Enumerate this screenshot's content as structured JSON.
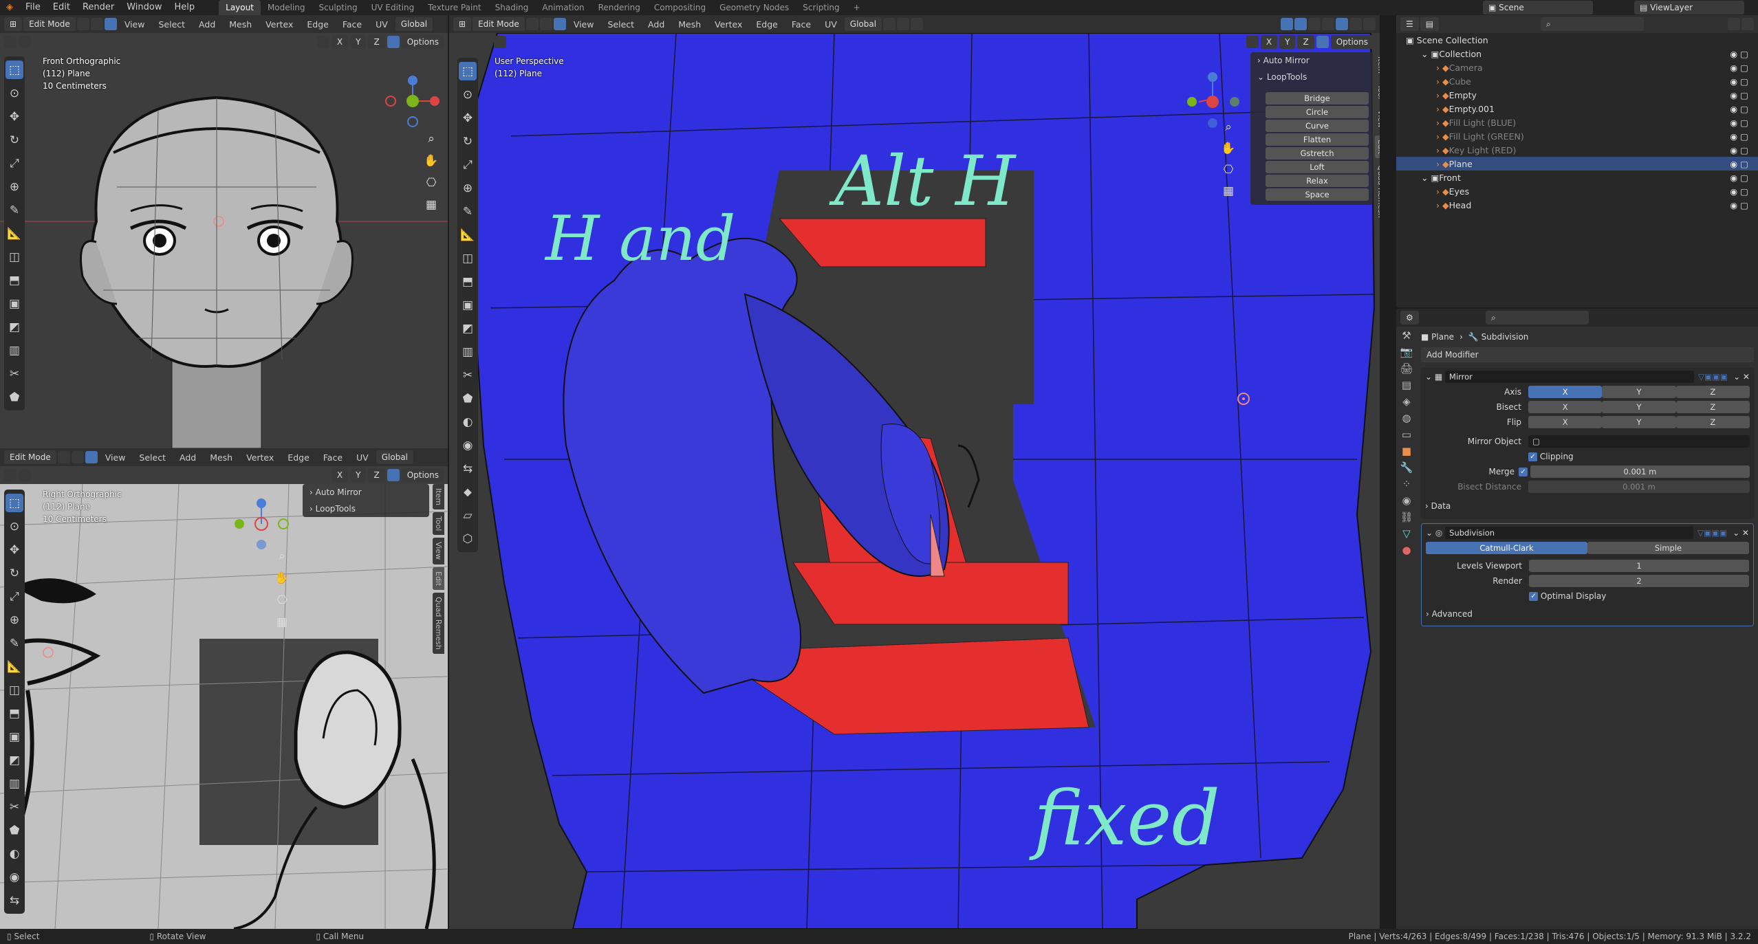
{
  "topbar": {
    "menus": [
      "File",
      "Edit",
      "Render",
      "Window",
      "Help"
    ],
    "workspaces": [
      "Layout",
      "Modeling",
      "Sculpting",
      "UV Editing",
      "Texture Paint",
      "Shading",
      "Animation",
      "Rendering",
      "Compositing",
      "Geometry Nodes",
      "Scripting"
    ],
    "active_ws": "Layout",
    "scene": "Scene",
    "viewlayer": "ViewLayer"
  },
  "vp_front": {
    "mode": "Edit Mode",
    "menus": [
      "View",
      "Select",
      "Add",
      "Mesh",
      "Vertex",
      "Edge",
      "Face",
      "UV"
    ],
    "orientation": "Global",
    "options": "Options",
    "axes": [
      "X",
      "Y",
      "Z"
    ],
    "info": [
      "Front Orthographic",
      "(112) Plane",
      "10 Centimeters"
    ]
  },
  "vp_right": {
    "mode": "Edit Mode",
    "menus": [
      "View",
      "Select",
      "Add",
      "Mesh",
      "Vertex",
      "Edge",
      "Face",
      "UV"
    ],
    "orientation": "Global",
    "options": "Options",
    "axes": [
      "X",
      "Y",
      "Z"
    ],
    "info": [
      "Right Orthographic",
      "(112) Plane",
      "10 Centimeters"
    ],
    "panels": [
      "Auto Mirror",
      "LoopTools"
    ]
  },
  "vp_main": {
    "mode": "Edit Mode",
    "menus": [
      "View",
      "Select",
      "Add",
      "Mesh",
      "Vertex",
      "Edge",
      "Face",
      "UV"
    ],
    "orientation": "Global",
    "options": "Options",
    "axes": [
      "X",
      "Y",
      "Z"
    ],
    "info": [
      "User Perspective",
      "(112) Plane"
    ],
    "panel_automirror": "Auto Mirror",
    "panel_looptools": "LoopTools",
    "looptools": [
      "Bridge",
      "Circle",
      "Curve",
      "Flatten",
      "Gstretch",
      "Loft",
      "Relax",
      "Space"
    ],
    "tabs": [
      "Item",
      "Tool",
      "View",
      "Edit",
      "Quad Remesh"
    ],
    "hand1": "H and",
    "hand2": "Alt H",
    "hand3": "fixed"
  },
  "outliner": {
    "root": "Scene Collection",
    "items": [
      {
        "name": "Collection",
        "depth": 1,
        "type": "collection"
      },
      {
        "name": "Camera",
        "depth": 2,
        "dim": true
      },
      {
        "name": "Cube",
        "depth": 2,
        "dim": true
      },
      {
        "name": "Empty",
        "depth": 2
      },
      {
        "name": "Empty.001",
        "depth": 2
      },
      {
        "name": "Fill Light (BLUE)",
        "depth": 2,
        "dim": true
      },
      {
        "name": "Fill Light (GREEN)",
        "depth": 2,
        "dim": true
      },
      {
        "name": "Key Light (RED)",
        "depth": 2,
        "dim": true
      },
      {
        "name": "Plane",
        "depth": 2,
        "selected": true
      },
      {
        "name": "Front",
        "depth": 1,
        "type": "collection"
      },
      {
        "name": "Eyes",
        "depth": 2
      },
      {
        "name": "Head",
        "depth": 2
      }
    ]
  },
  "props": {
    "breadcrumb_obj": "Plane",
    "breadcrumb_mod": "Subdivision",
    "add_modifier": "Add Modifier",
    "mirror": {
      "name": "Mirror",
      "axis_label": "Axis",
      "bisect_label": "Bisect",
      "flip_label": "Flip",
      "xyz": [
        "X",
        "Y",
        "Z"
      ],
      "mirror_object": "Mirror Object",
      "clipping": "Clipping",
      "merge": "Merge",
      "merge_val": "0.001 m",
      "bisect_dist": "Bisect Distance",
      "bisect_dist_val": "0.001 m",
      "data": "Data"
    },
    "subdiv": {
      "name": "Subdivision",
      "catmull": "Catmull-Clark",
      "simple": "Simple",
      "levels_label": "Levels Viewport",
      "levels": "1",
      "render_label": "Render",
      "render": "2",
      "optimal": "Optimal Display",
      "advanced": "Advanced"
    }
  },
  "status": {
    "select": "Select",
    "rotate": "Rotate View",
    "menu": "Call Menu",
    "stats": "Plane | Verts:4/263 | Edges:8/499 | Faces:1/238 | Tris:476 | Objects:1/5 | Memory: 91.3 MiB | 3.2.2"
  }
}
